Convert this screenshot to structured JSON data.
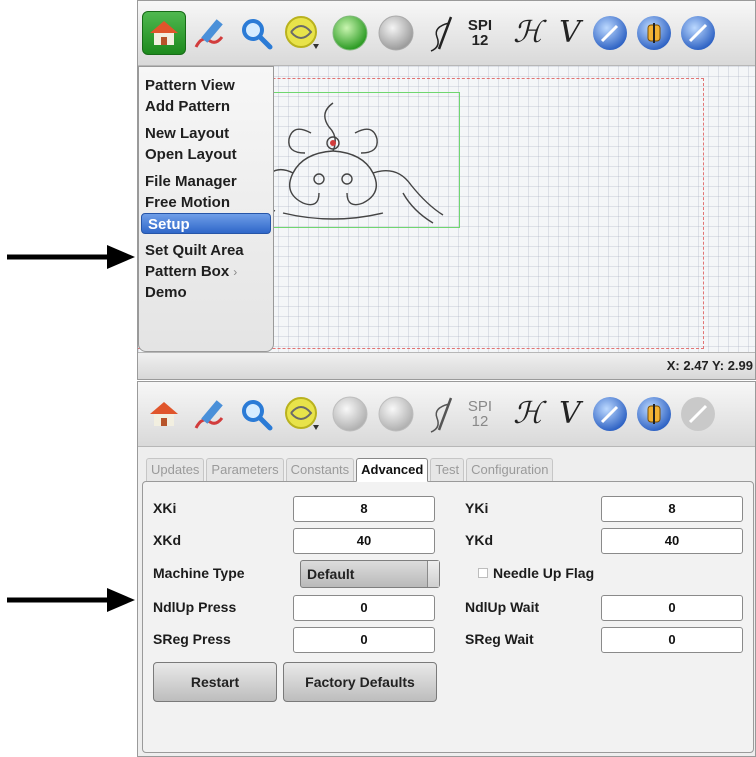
{
  "toolbar": {
    "icons": [
      "home-icon",
      "pencil-icon",
      "zoom-icon",
      "pattern-tool-icon",
      "green-light-icon",
      "gray-light-icon",
      "needle-thread-icon",
      "spi-indicator",
      "h-icon",
      "v-icon",
      "speed-dial-icon",
      "needle-up-icon",
      "wrench-icon"
    ],
    "spi_label": "SPI",
    "spi_value": "12",
    "h_glyph": "ℋ",
    "v_glyph": "V"
  },
  "menu": {
    "items": [
      {
        "label": "Pattern View"
      },
      {
        "label": "Add Pattern"
      },
      {
        "label": "New Layout"
      },
      {
        "label": "Open Layout"
      },
      {
        "label": "File Manager"
      },
      {
        "label": "Free Motion"
      },
      {
        "label": "Setup",
        "selected": true
      },
      {
        "label": "Set Quilt Area"
      },
      {
        "label": "Pattern Box",
        "submenu_marker": "›"
      },
      {
        "label": "Demo"
      }
    ]
  },
  "status": {
    "coords": "X: 2.47 Y: 2.99"
  },
  "settings": {
    "tabs": [
      "Updates",
      "Parameters",
      "Constants",
      "Advanced",
      "Test",
      "Configuration"
    ],
    "active_tab": "Advanced",
    "fields": {
      "xki_label": "XKi",
      "xki_value": "8",
      "yki_label": "YKi",
      "yki_value": "8",
      "xkd_label": "XKd",
      "xkd_value": "40",
      "ykd_label": "YKd",
      "ykd_value": "40",
      "machine_type_label": "Machine Type",
      "machine_type_value": "Default",
      "needle_up_flag_label": "Needle Up Flag",
      "needle_up_flag_checked": false,
      "ndlup_press_label": "NdlUp Press",
      "ndlup_press_value": "0",
      "ndlup_wait_label": "NdlUp Wait",
      "ndlup_wait_value": "0",
      "sreg_press_label": "SReg Press",
      "sreg_press_value": "0",
      "sreg_wait_label": "SReg Wait",
      "sreg_wait_value": "0"
    },
    "buttons": {
      "restart": "Restart",
      "factory_defaults": "Factory Defaults"
    }
  },
  "colors": {
    "selection_blue": "#3f74d2",
    "home_active_green": "#2e9e2e",
    "quilt_border_red": "#e27474",
    "pattern_box_green": "#6fd66f"
  }
}
